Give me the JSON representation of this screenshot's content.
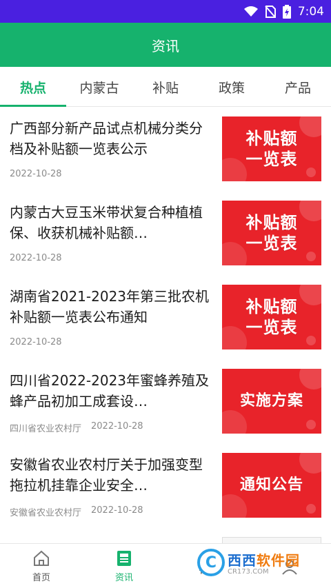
{
  "status_bar": {
    "time": "7:04",
    "icons": [
      "wifi-icon",
      "no-sim-icon",
      "battery-charging-icon"
    ]
  },
  "app_bar": {
    "title": "资讯"
  },
  "tabs": [
    {
      "label": "热点",
      "active": true
    },
    {
      "label": "内蒙古",
      "active": false
    },
    {
      "label": "补贴",
      "active": false
    },
    {
      "label": "政策",
      "active": false
    },
    {
      "label": "产品",
      "active": false
    }
  ],
  "articles": [
    {
      "title": "广西部分新产品试点机械分类分档及补贴额一览表公示",
      "source": "",
      "date": "2022-10-28",
      "thumb_line1": "补贴额",
      "thumb_line2": "一览表"
    },
    {
      "title": "内蒙古大豆玉米带状复合种植植保、收获机械补贴额…",
      "source": "",
      "date": "2022-10-28",
      "thumb_line1": "补贴额",
      "thumb_line2": "一览表"
    },
    {
      "title": "湖南省2021-2023年第三批农机补贴额一览表公布通知",
      "source": "",
      "date": "2022-10-28",
      "thumb_line1": "补贴额",
      "thumb_line2": "一览表"
    },
    {
      "title": "四川省2022-2023年蜜蜂养殖及蜂产品初加工成套设…",
      "source": "四川省农业农村厅",
      "date": "2022-10-28",
      "thumb_line1": "实施方案",
      "thumb_line2": ""
    },
    {
      "title": "安徽省农业农村厅关于加强变型拖拉机挂靠企业安全…",
      "source": "安徽省农业农村厅",
      "date": "2022-10-28",
      "thumb_line1": "通知公告",
      "thumb_line2": ""
    }
  ],
  "bottom_nav": [
    {
      "label": "首页",
      "icon": "home-icon",
      "active": false
    },
    {
      "label": "资讯",
      "icon": "news-icon",
      "active": true
    },
    {
      "label": "",
      "icon": "chat-icon",
      "active": false
    },
    {
      "label": "",
      "icon": "profile-icon",
      "active": false
    }
  ],
  "watermark": {
    "cn_part1": "西西",
    "cn_part2": "软件园",
    "en": "CR173.COM"
  },
  "colors": {
    "status_bar": "#4a20e0",
    "brand_green": "#16b26d",
    "thumb_red": "#e8232a"
  }
}
